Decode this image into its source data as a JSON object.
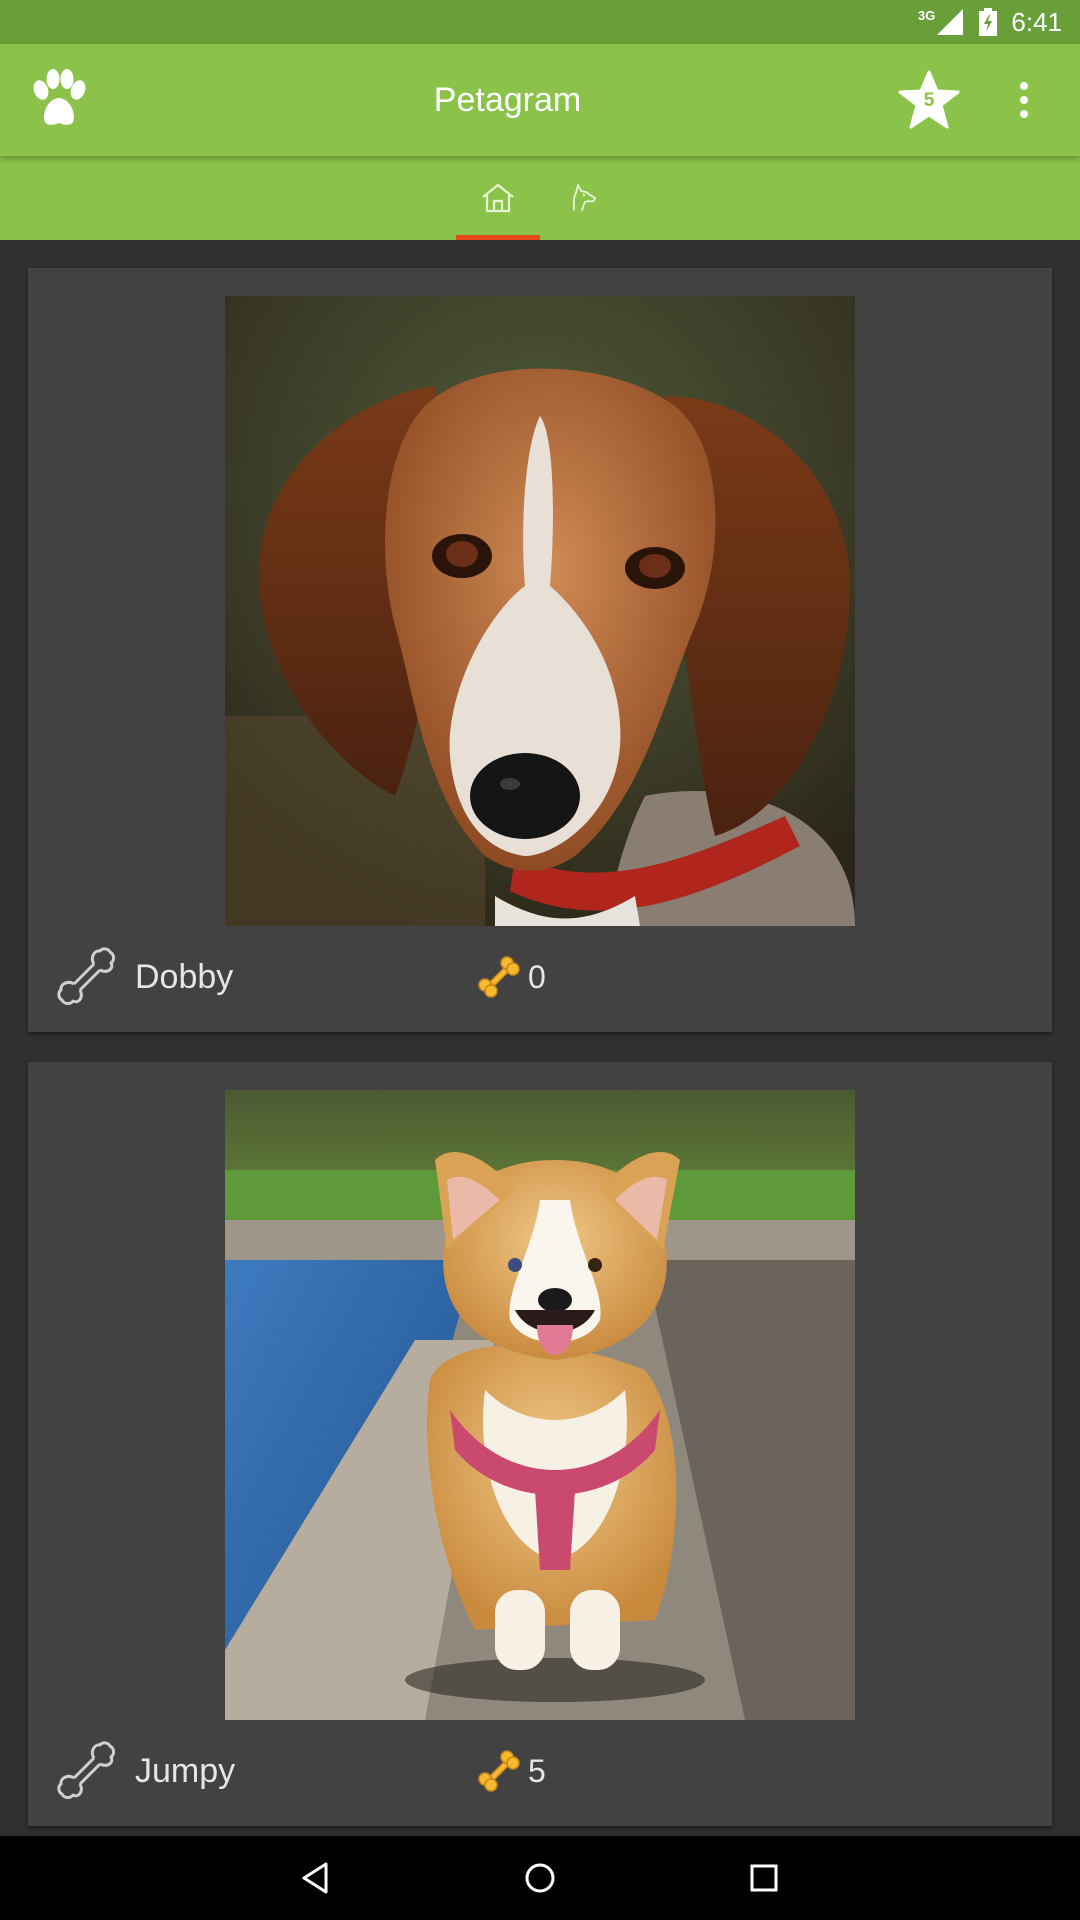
{
  "status_bar": {
    "network": "3G",
    "time": "6:41"
  },
  "app_bar": {
    "logo_icon": "paw-icon",
    "title": "Petagram",
    "favorites_icon": "star-icon",
    "favorites_count": "5",
    "menu_icon": "more-vert-icon"
  },
  "tabs": [
    {
      "icon": "home-icon",
      "selected": true
    },
    {
      "icon": "dog-icon",
      "selected": false
    }
  ],
  "colors": {
    "status_bar": "#689f38",
    "primary": "#8bc34a",
    "tab_indicator": "#e64a19",
    "card_bg": "#424242",
    "page_bg": "#303030",
    "bone_gold": "#f5b82e"
  },
  "pets": [
    {
      "name": "Dobby",
      "likes": "0",
      "photo": "beagle-photo",
      "rate_icon": "bone-outline-icon",
      "like_icon": "bone-filled-icon"
    },
    {
      "name": "Jumpy",
      "likes": "5",
      "photo": "corgi-photo",
      "rate_icon": "bone-outline-icon",
      "like_icon": "bone-filled-icon"
    }
  ],
  "nav_bar": {
    "back_icon": "back-triangle-icon",
    "home_icon": "home-circle-icon",
    "recents_icon": "recents-square-icon"
  }
}
